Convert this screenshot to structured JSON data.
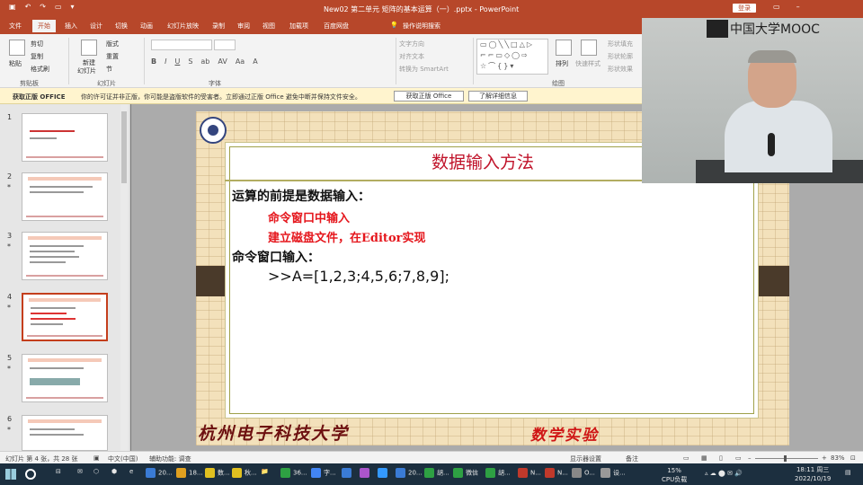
{
  "window": {
    "title": "New02 第二单元 矩阵的基本运算（一）.pptx - PowerPoint",
    "login": "登录"
  },
  "tabs": [
    "文件",
    "开始",
    "插入",
    "设计",
    "切换",
    "动画",
    "幻灯片放映",
    "录制",
    "审阅",
    "视图",
    "加载项",
    "百度网盘",
    "操作说明搜索"
  ],
  "ribbon": {
    "paste": "粘贴",
    "cut": "剪切",
    "copy": "复制",
    "format_painter": "格式刷",
    "clipboard_group": "剪贴板",
    "new_slide": "新建",
    "new_slide2": "幻灯片",
    "layout": "版式",
    "reset": "重置",
    "section": "节",
    "slides_group": "幻灯片",
    "font_group": "字体",
    "text_direction": "文字方向",
    "align_text": "对齐文本",
    "convert_smartart": "转换为 SmartArt",
    "arrange": "排列",
    "quick_styles": "快速样式",
    "shape_fill": "形状填充",
    "shape_outline": "形状轮廓",
    "shape_effects": "形状效果",
    "drawing_group": "绘图"
  },
  "infobar": {
    "label": "获取正版 OFFICE",
    "message": "你的许可证并非正版，你可能是盗版软件的受害者。立即通过正版 Office 避免中断并保持文件安全。",
    "get_genuine": "获取正版 Office",
    "learn_more": "了解详细信息"
  },
  "thumbnails": [
    {
      "num": "1",
      "star": ""
    },
    {
      "num": "2",
      "star": "*"
    },
    {
      "num": "3",
      "star": "*"
    },
    {
      "num": "4",
      "star": "*"
    },
    {
      "num": "5",
      "star": "*"
    },
    {
      "num": "6",
      "star": "*"
    }
  ],
  "slide": {
    "title": "数据输入方法",
    "line1": "运算的前提是数据输入：",
    "line2": "命令窗口中输入",
    "line3": "建立磁盘文件，在Editor实现",
    "line4": "命令窗口输入：",
    "line5": ">>A=[1,2,3;4,5,6;7,8,9];",
    "footer_left": "杭州电子科技大学",
    "footer_right": "数学实验"
  },
  "video": {
    "brand": "中国大学MOOC"
  },
  "status": {
    "slide_info": "幻灯片 第 4 张，共 28 张",
    "language": "中文(中国)",
    "accessibility": "辅助功能: 调查",
    "display_settings": "显示器设置",
    "notes": "备注",
    "zoom": "83%"
  },
  "taskbar": {
    "items": [
      "20...",
      "18...",
      "数...",
      "秋...",
      "36...",
      "字...",
      "20...",
      "胡...",
      "微信",
      "胡...",
      "N...",
      "N...",
      "O...",
      "设..."
    ],
    "cpu": "15%",
    "cpu_label": "CPU负载",
    "time": "18:11 周三",
    "date": "2022/10/19"
  },
  "colors": {
    "accent": "#b7472a",
    "slide_title": "#c0132a",
    "slide_red_text": "#e5161c",
    "infobar": "#fff4ce"
  }
}
